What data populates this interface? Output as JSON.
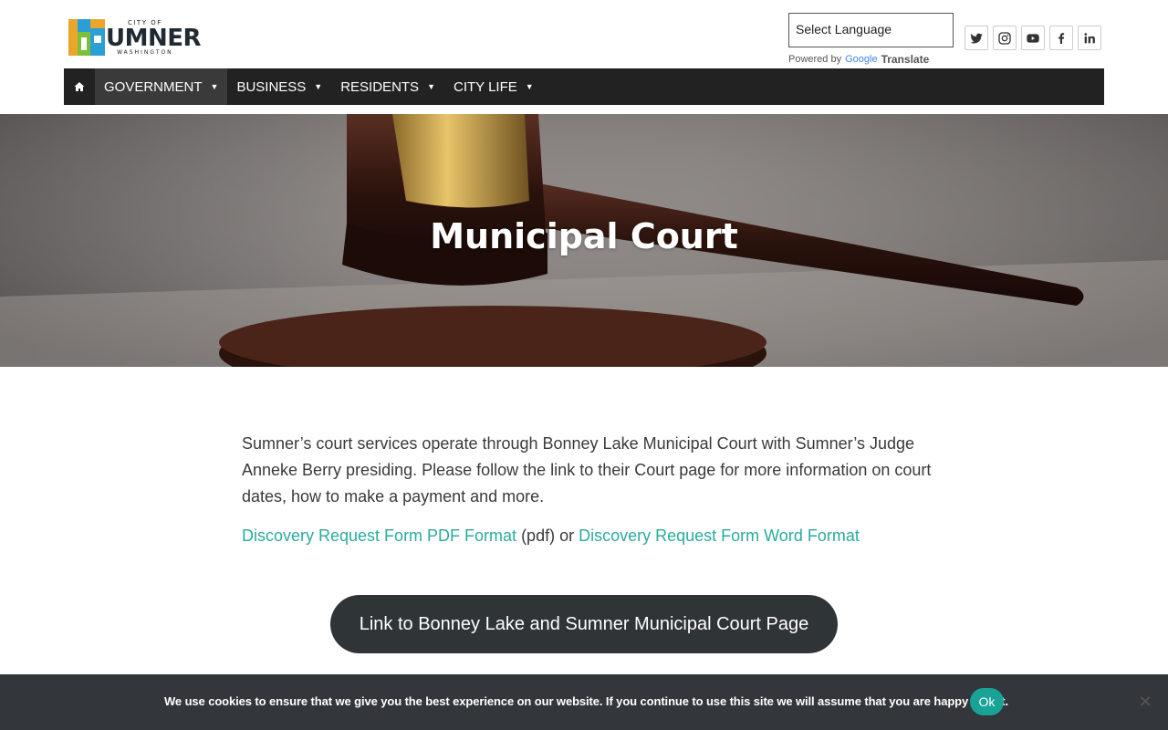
{
  "logo": {
    "top": "CITY OF",
    "main": "SUMNER",
    "sub": "WASHINGTON"
  },
  "language": {
    "select_label": "Select Language",
    "powered_by": "Powered by",
    "google": "Google",
    "translate": "Translate"
  },
  "socials": [
    {
      "icon": "twitter-icon"
    },
    {
      "icon": "instagram-icon"
    },
    {
      "icon": "youtube-icon"
    },
    {
      "icon": "facebook-icon"
    },
    {
      "icon": "linkedin-icon"
    }
  ],
  "nav": {
    "items": [
      {
        "label": "GOVERNMENT",
        "active": true
      },
      {
        "label": "BUSINESS"
      },
      {
        "label": "RESIDENTS"
      },
      {
        "label": "CITY LIFE"
      }
    ]
  },
  "hero": {
    "title": "Municipal Court"
  },
  "content": {
    "paragraph": "Sumner’s court services operate through Bonney Lake Municipal Court with Sumner’s Judge Anneke Berry presiding.  Please follow the link to their Court page for more information on court dates, how to make a payment and more.",
    "link_pdf": "Discovery Request Form PDF Format",
    "pdf_note": " (pdf) or ",
    "link_word": "Discovery Request Form Word Format",
    "button": "Link to Bonney Lake and Sumner Municipal Court Page"
  },
  "cookie": {
    "text": "We use cookies to ensure that we give you the best experience on our website. If you continue to use this site we will assume that you are happy with it.",
    "ok": "Ok",
    "close": "✕"
  },
  "colors": {
    "accent": "#2bab9c",
    "nav_bg": "#222222",
    "button_bg": "#2f3437",
    "cookie_bg": "#33373b",
    "ok_bg": "#19a396"
  }
}
